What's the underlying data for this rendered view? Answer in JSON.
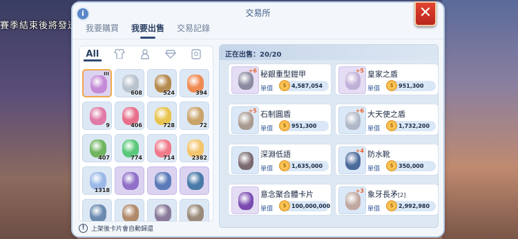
{
  "background": {
    "banner_text": "賽季結束後將發送"
  },
  "window": {
    "title": "交易所",
    "info_icon": "i",
    "close_label": "✕",
    "tabs": [
      {
        "label": "我要購買"
      },
      {
        "label": "我要出售"
      },
      {
        "label": "交易記錄"
      }
    ],
    "active_tab": 1
  },
  "inventory": {
    "categories": [
      {
        "label": "All"
      },
      {
        "icon": "armor-icon"
      },
      {
        "icon": "potion-icon"
      },
      {
        "icon": "gem-icon"
      },
      {
        "icon": "card-icon"
      }
    ],
    "items": [
      {
        "icon": "armor-item",
        "count": "",
        "tier": "III",
        "bg": "purple"
      },
      {
        "icon": "blade-item",
        "count": "608",
        "bg": "blue"
      },
      {
        "icon": "fur-item",
        "count": "524",
        "bg": "blue"
      },
      {
        "icon": "fruit-item",
        "count": "394",
        "bg": "blue"
      },
      {
        "icon": "flower-item",
        "count": "9",
        "bg": "blue"
      },
      {
        "icon": "candy-item",
        "count": "406",
        "bg": "blue"
      },
      {
        "icon": "pear-item",
        "count": "728",
        "bg": "blue"
      },
      {
        "icon": "vase-item",
        "count": "72",
        "bg": "blue"
      },
      {
        "icon": "bottle-item",
        "count": "407",
        "bg": "blue"
      },
      {
        "icon": "bolt-item",
        "count": "774",
        "bg": "blue"
      },
      {
        "icon": "heart-item",
        "count": "714",
        "bg": "blue"
      },
      {
        "icon": "feather-item",
        "count": "2382",
        "bg": "blue"
      },
      {
        "icon": "crystal-item",
        "count": "1318",
        "bg": "blue"
      },
      {
        "icon": "book-item",
        "count": "",
        "bg": "purple"
      },
      {
        "icon": "card-book-item",
        "count": "",
        "bg": "purple"
      },
      {
        "icon": "card-book-item-2",
        "count": "",
        "bg": "purple"
      },
      {
        "icon": "spike-item",
        "count": "",
        "bg": "blue"
      },
      {
        "icon": "claw-item",
        "count": "",
        "bg": "blue"
      },
      {
        "icon": "mask-item",
        "count": "",
        "bg": "blue"
      },
      {
        "icon": "horn-item",
        "count": "",
        "bg": "blue"
      }
    ],
    "note": "上架後卡片會自動歸還",
    "note_icon": "!"
  },
  "listing": {
    "header_label": "正在出售：",
    "header_count": "20/20",
    "price_label": "單價",
    "items": [
      {
        "name": "秘銀重型鎧甲",
        "price": "4,587,054",
        "icon": "armor-icon",
        "level": "+6"
      },
      {
        "name": "皇家之盾",
        "price": "951,300",
        "icon": "shield-icon",
        "level": "+5"
      },
      {
        "name": "石制圓盾",
        "price": "951,300",
        "icon": "round-shield-icon",
        "level": "+5"
      },
      {
        "name": "大天使之盾",
        "price": "1,732,200",
        "icon": "angel-shield-icon",
        "level": "+6"
      },
      {
        "name": "深淵低語",
        "price": "1,635,000",
        "icon": "necklace-icon",
        "level": ""
      },
      {
        "name": "防水靴",
        "price": "350,000",
        "icon": "boots-icon",
        "level": "+4"
      },
      {
        "name": "意念聚合體卡片",
        "price": "100,000,000",
        "icon": "card-icon",
        "level": ""
      },
      {
        "name": "象牙長矛",
        "suffix": "[2]",
        "price": "2,992,980",
        "icon": "spear-icon",
        "level": "+3"
      }
    ]
  },
  "colors": {
    "accent": "#2f4a75",
    "coin": "#f0a32a",
    "close": "#d63a2a"
  }
}
